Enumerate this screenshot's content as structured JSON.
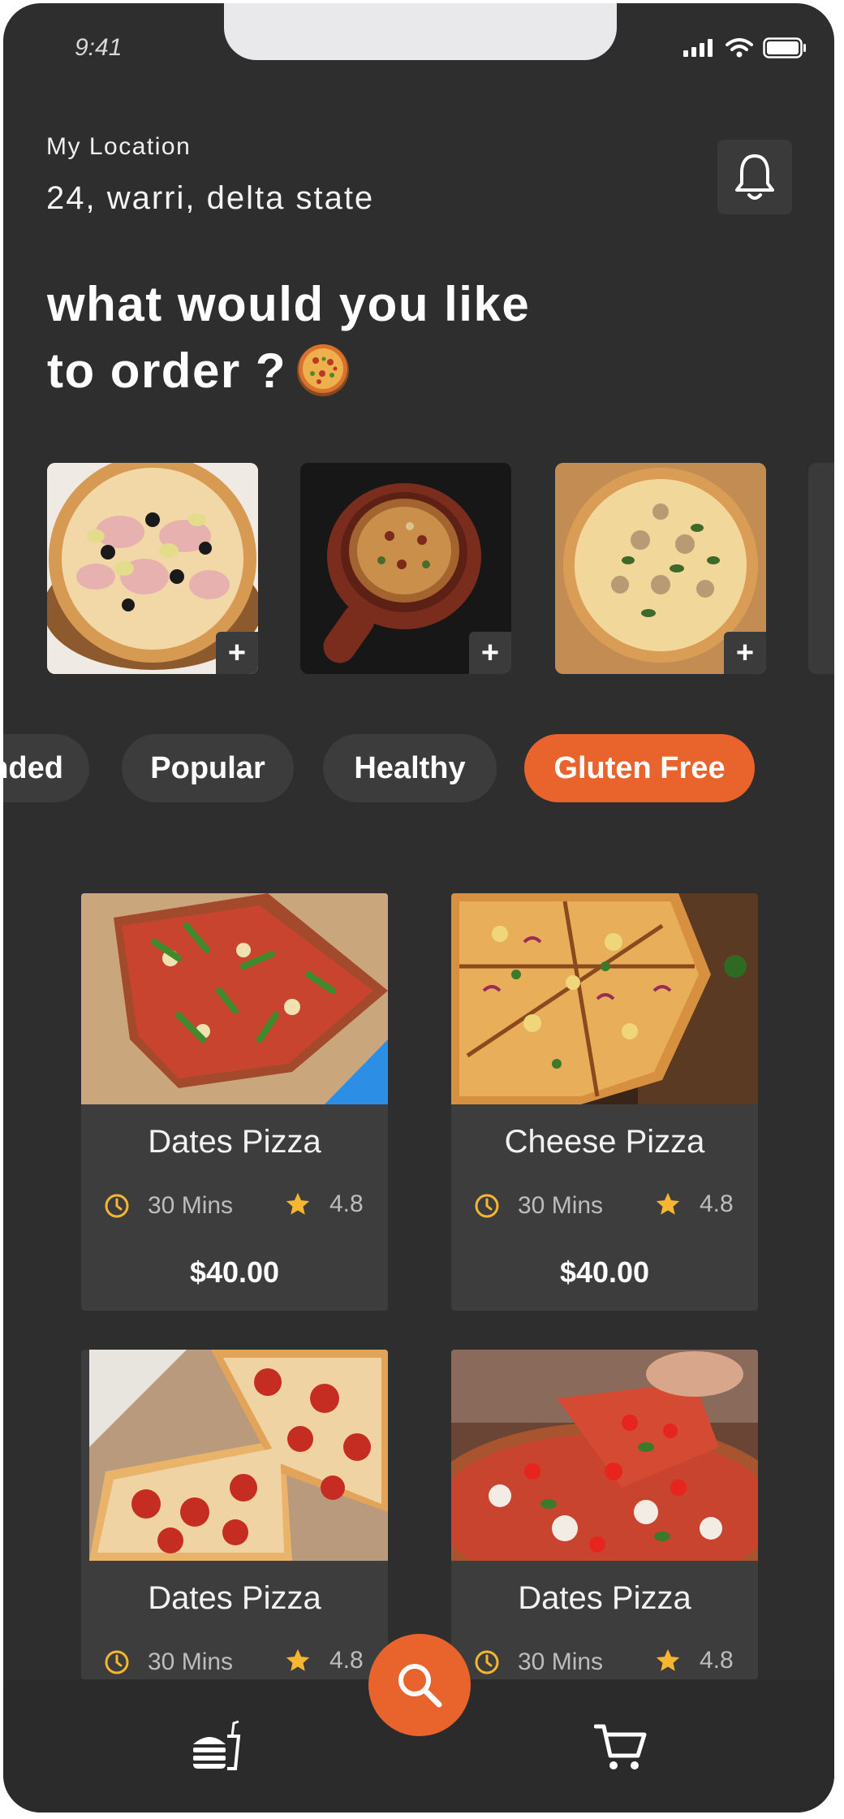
{
  "status_bar": {
    "time": "9:41"
  },
  "location": {
    "label": "My Location",
    "value": "24, warri, delta state"
  },
  "headline": {
    "line1": "what would you like",
    "line2": "to order ?"
  },
  "categories": [
    "nded",
    "Popular",
    "Healthy",
    "Gluten Free"
  ],
  "active_category": "Gluten Free",
  "products": [
    {
      "name": "Dates Pizza",
      "time": "30 Mins",
      "rating": "4.8",
      "price": "$40.00"
    },
    {
      "name": "Cheese Pizza",
      "time": "30 Mins",
      "rating": "4.8",
      "price": "$40.00"
    },
    {
      "name": "Dates Pizza",
      "time": "30 Mins",
      "rating": "4.8"
    },
    {
      "name": "Dates Pizza",
      "time": "30 Mins",
      "rating": "4.8"
    }
  ],
  "icons": {
    "bell": "bell-icon",
    "add": "plus-icon",
    "clock": "clock-icon",
    "star": "star-icon",
    "search": "search-icon",
    "food": "burger-drink-icon",
    "cart": "cart-icon"
  },
  "colors": {
    "background": "#2e2e2e",
    "accent": "#e9632c",
    "card": "#3d3d3d",
    "star": "#f5b731"
  }
}
